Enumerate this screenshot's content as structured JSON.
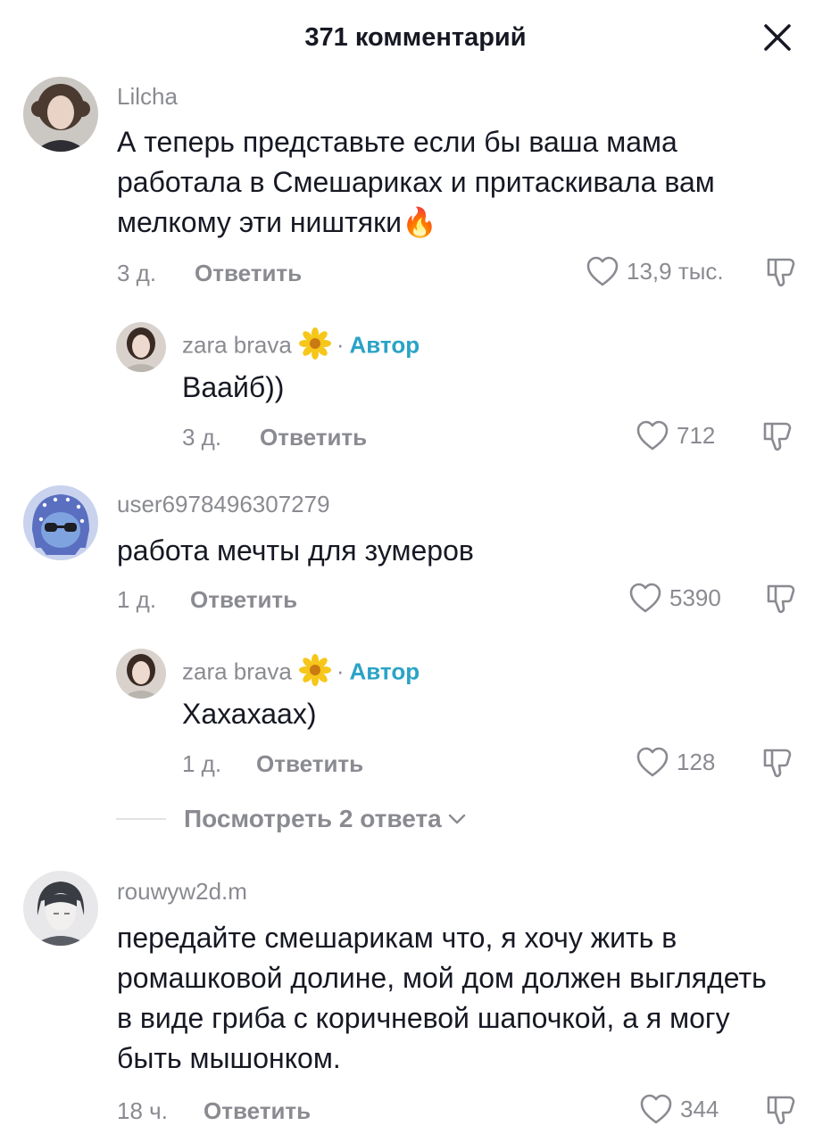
{
  "header": {
    "title": "371 комментарий"
  },
  "comments": [
    {
      "username": "Lilcha",
      "text": "А теперь представьте если бы ваша мама работала в Смешариках и притаскивала вам мелкому эти ништяки",
      "emoji": "🔥",
      "time": "3 д.",
      "reply_label": "Ответить",
      "likes": "13,9 тыс.",
      "reply": {
        "username": "zara brava",
        "badge_separator": "·",
        "badge": "Автор",
        "text": "Ваайб))",
        "time": "3 д.",
        "reply_label": "Ответить",
        "likes": "712"
      }
    },
    {
      "username": "user6978496307279",
      "text": "работа мечты для зумеров",
      "time": "1 д.",
      "reply_label": "Ответить",
      "likes": "5390",
      "reply": {
        "username": "zara brava",
        "badge_separator": "·",
        "badge": "Автор",
        "text": "Хахахаах)",
        "time": "1 д.",
        "reply_label": "Ответить",
        "likes": "128"
      },
      "view_more": "Посмотреть 2 ответа"
    },
    {
      "username": "rouwyw2d.m",
      "text": "передайте смешарикам что, я хочу жить в ромашковой долине, мой дом должен выглядеть в виде гриба с коричневой шапочкой, а я могу быть мышонком.",
      "time": "18 ч.",
      "reply_label": "Ответить",
      "likes": "344"
    }
  ],
  "colors": {
    "author_badge": "#2aa3c6",
    "muted": "#8a8b91",
    "text": "#161823"
  },
  "icons": [
    "close-icon",
    "heart-icon",
    "dislike-icon",
    "flower-icon",
    "chevron-down-icon",
    "fire-emoji"
  ]
}
